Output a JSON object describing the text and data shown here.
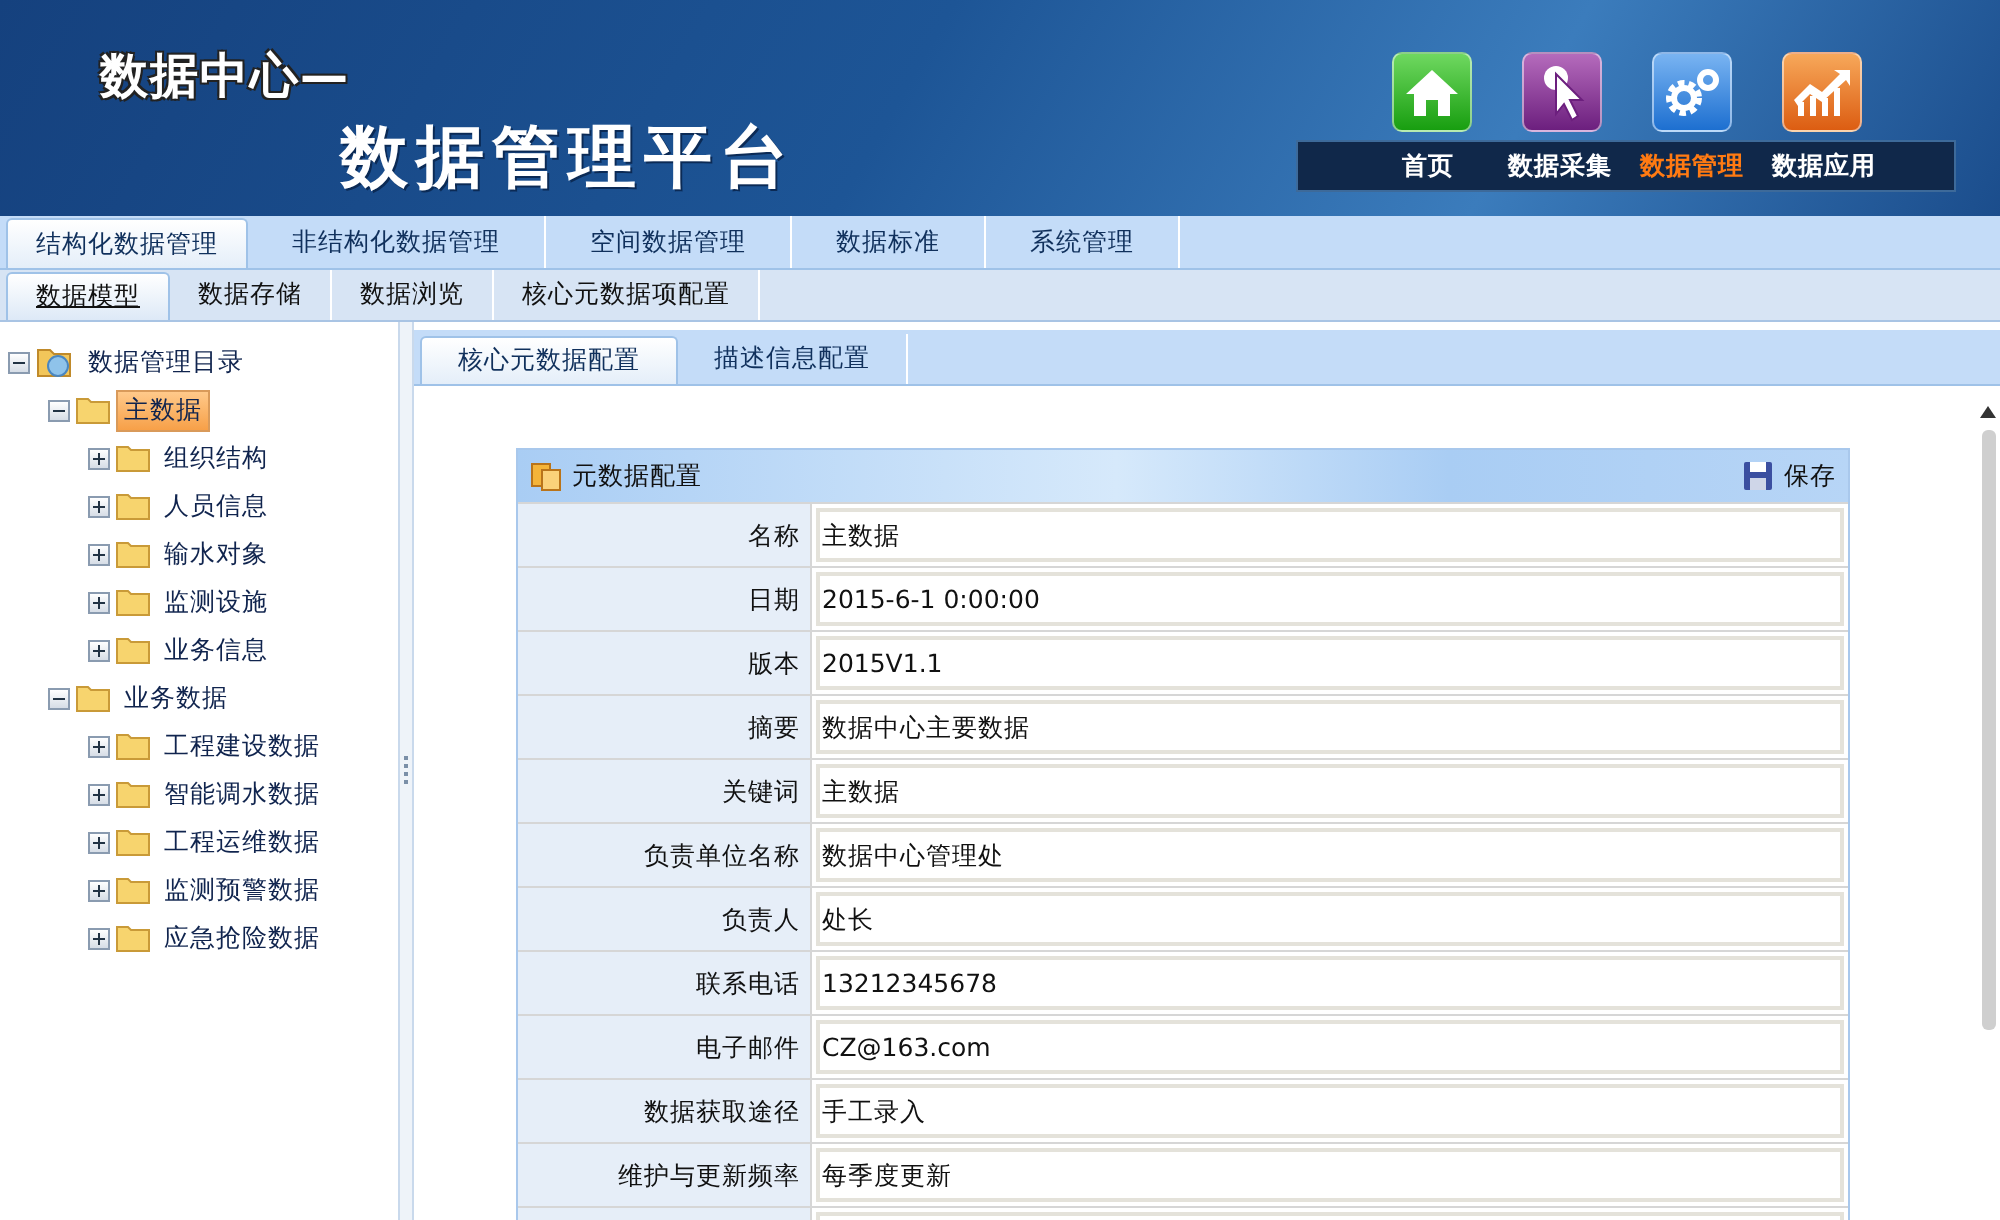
{
  "header": {
    "title_small": "数据中心—",
    "title_large": "数据管理平台",
    "nav": [
      {
        "kind": "home",
        "label": "首页",
        "selected": false
      },
      {
        "kind": "collect",
        "label": "数据采集",
        "selected": false
      },
      {
        "kind": "manage",
        "label": "数据管理",
        "selected": true
      },
      {
        "kind": "apply",
        "label": "数据应用",
        "selected": false
      }
    ]
  },
  "main_tabs": [
    {
      "label": "结构化数据管理",
      "selected": true
    },
    {
      "label": "非结构化数据管理",
      "selected": false
    },
    {
      "label": "空间数据管理",
      "selected": false
    },
    {
      "label": "数据标准",
      "selected": false
    },
    {
      "label": "系统管理",
      "selected": false
    }
  ],
  "sub_tabs": [
    {
      "label": "数据模型",
      "selected": true
    },
    {
      "label": "数据存储",
      "selected": false
    },
    {
      "label": "数据浏览",
      "selected": false
    },
    {
      "label": "核心元数据项配置",
      "selected": false
    }
  ],
  "tree": [
    {
      "label": "数据管理目录",
      "kind": "root",
      "expanded": true,
      "selected": false,
      "children": [
        {
          "label": "主数据",
          "kind": "folder",
          "expanded": true,
          "selected": true,
          "children": [
            {
              "label": "组织结构",
              "kind": "folder",
              "expanded": false,
              "selected": false
            },
            {
              "label": "人员信息",
              "kind": "folder",
              "expanded": false,
              "selected": false
            },
            {
              "label": "输水对象",
              "kind": "folder",
              "expanded": false,
              "selected": false
            },
            {
              "label": "监测设施",
              "kind": "folder",
              "expanded": false,
              "selected": false
            },
            {
              "label": "业务信息",
              "kind": "folder",
              "expanded": false,
              "selected": false
            }
          ]
        },
        {
          "label": "业务数据",
          "kind": "folder",
          "expanded": true,
          "selected": false,
          "children": [
            {
              "label": "工程建设数据",
              "kind": "folder",
              "expanded": false,
              "selected": false
            },
            {
              "label": "智能调水数据",
              "kind": "folder",
              "expanded": false,
              "selected": false
            },
            {
              "label": "工程运维数据",
              "kind": "folder",
              "expanded": false,
              "selected": false
            },
            {
              "label": "监测预警数据",
              "kind": "folder",
              "expanded": false,
              "selected": false
            },
            {
              "label": "应急抢险数据",
              "kind": "folder",
              "expanded": false,
              "selected": false
            }
          ]
        }
      ]
    }
  ],
  "content_tabs": [
    {
      "label": "核心元数据配置",
      "selected": true
    },
    {
      "label": "描述信息配置",
      "selected": false
    }
  ],
  "form": {
    "title": "元数据配置",
    "save_label": "保存",
    "fields": [
      {
        "label": "名称",
        "value": "主数据"
      },
      {
        "label": "日期",
        "value": "2015-6-1 0:00:00"
      },
      {
        "label": "版本",
        "value": "2015V1.1"
      },
      {
        "label": "摘要",
        "value": "数据中心主要数据"
      },
      {
        "label": "关键词",
        "value": "主数据"
      },
      {
        "label": "负责单位名称",
        "value": "数据中心管理处"
      },
      {
        "label": "负责人",
        "value": "处长"
      },
      {
        "label": "联系电话",
        "value": "13212345678"
      },
      {
        "label": "电子邮件",
        "value": "CZ@163.com"
      },
      {
        "label": "数据获取途径",
        "value": "手工录入"
      },
      {
        "label": "维护与更新频率",
        "value": "每季度更新"
      }
    ]
  }
}
